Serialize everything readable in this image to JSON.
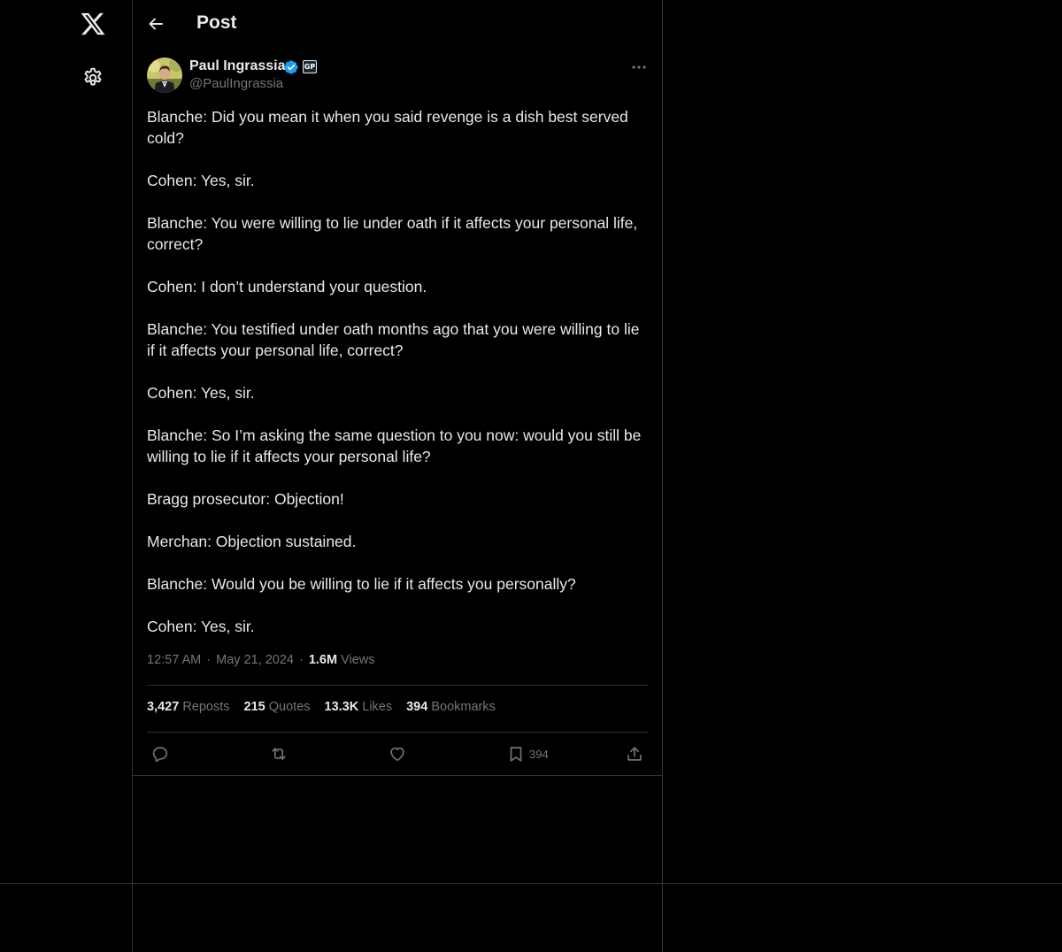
{
  "header": {
    "title": "Post"
  },
  "nav": {
    "logo_icon": "x-logo-icon",
    "settings_icon": "gear-icon"
  },
  "post": {
    "author": {
      "name": "Paul Ingrassia",
      "handle": "@PaulIngrassia",
      "verified": true,
      "affiliate_badge": "GP",
      "verified_color": "#1d9bf0"
    },
    "paragraphs": [
      "Blanche: Did you mean it when you said revenge is a dish best served cold?",
      "Cohen: Yes, sir.",
      "Blanche: You were willing to lie under oath if it affects your personal life, correct?",
      "Cohen: I don’t understand your question.",
      "Blanche: You testified under oath months ago that you were willing to lie if it affects your personal life, correct?",
      "Cohen: Yes, sir.",
      "Blanche: So I’m asking the same question to you now: would you still be willing to lie if it affects your personal life?",
      "Bragg prosecutor: Objection!",
      "Merchan: Objection sustained.",
      "Blanche: Would you be willing to lie if it affects you personally?",
      "Cohen: Yes, sir."
    ],
    "time": "12:57 AM",
    "date": "May 21, 2024",
    "views_count": "1.6M",
    "views_label": "Views",
    "stats": {
      "reposts_count": "3,427",
      "reposts_label": "Reposts",
      "quotes_count": "215",
      "quotes_label": "Quotes",
      "likes_count": "13.3K",
      "likes_label": "Likes",
      "bookmarks_count": "394",
      "bookmarks_label": "Bookmarks"
    },
    "actions": {
      "bookmark_count": "394"
    }
  }
}
